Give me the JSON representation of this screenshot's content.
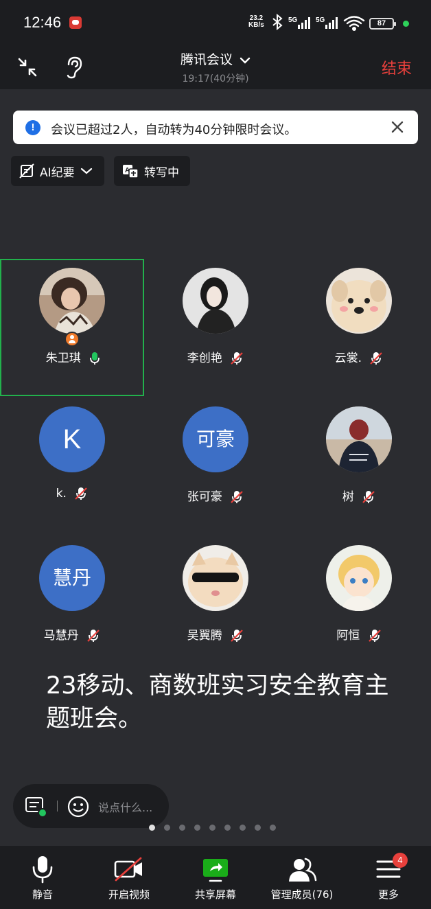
{
  "status_bar": {
    "time": "12:46",
    "net_speed_value": "23.2",
    "net_speed_unit": "KB/s",
    "network_1": "5G",
    "network_2": "5G",
    "battery": "87"
  },
  "header": {
    "title": "腾讯会议",
    "meeting_time": "19:17(40分钟)",
    "end_label": "结束"
  },
  "notice": {
    "text": "会议已超过2人，自动转为40分钟限时会议。",
    "icon": "info-icon"
  },
  "chips": {
    "ai_summary": "AI纪要",
    "transcribing": "转写中"
  },
  "participants": [
    {
      "name": "朱卫琪",
      "mic": "on",
      "host": true,
      "avatar": "photo"
    },
    {
      "name": "李创艳",
      "mic": "muted",
      "avatar": "photo"
    },
    {
      "name": "云裳.",
      "mic": "muted",
      "avatar": "photo"
    },
    {
      "name": "k.",
      "mic": "muted",
      "avatar_text": "K"
    },
    {
      "name": "张可豪",
      "mic": "muted",
      "avatar_text": "可豪"
    },
    {
      "name": "树",
      "mic": "muted",
      "avatar": "photo"
    },
    {
      "name": "马慧丹",
      "mic": "muted",
      "avatar_text": "慧丹"
    },
    {
      "name": "吴翼腾",
      "mic": "muted",
      "avatar": "photo"
    },
    {
      "name": "阿恒",
      "mic": "muted",
      "avatar": "photo"
    }
  ],
  "caption": "23移动、商数班实习安全教育主题班会。",
  "chat": {
    "placeholder": "说点什么..."
  },
  "pager": {
    "total": 9,
    "current": 1
  },
  "toolbar": {
    "mute_label": "静音",
    "video_label": "开启视频",
    "share_label": "共享屏幕",
    "members_label": "管理成员(76)",
    "more_label": "更多",
    "more_badge": "4"
  },
  "colors": {
    "background": "#2b2c30",
    "bar": "#1c1d20",
    "end_red": "#e8403c",
    "active_green": "#22b14c",
    "share_green": "#1aad19",
    "avatar_blue": "#3d6fc6"
  }
}
